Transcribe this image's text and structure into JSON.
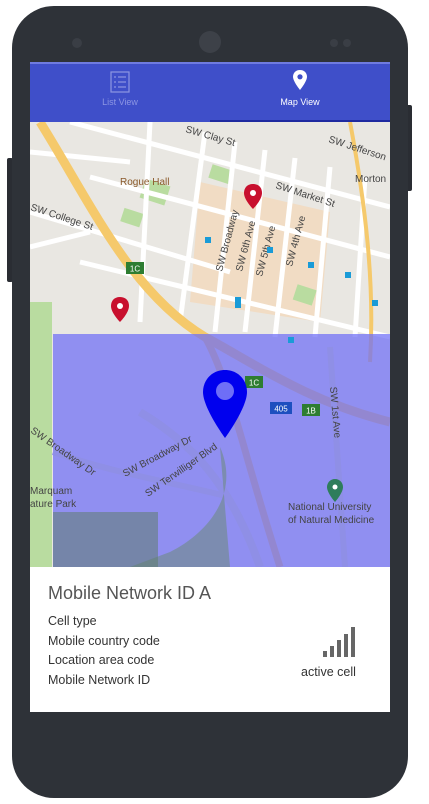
{
  "tabs": [
    {
      "label": "List View",
      "icon": "list-icon",
      "active": false
    },
    {
      "label": "Map View",
      "icon": "map-pin-icon",
      "active": true
    }
  ],
  "map": {
    "street_labels": {
      "clay": "SW Clay St",
      "jefferson": "SW Jefferson",
      "market": "SW Market St",
      "morton": "Morton",
      "rogue": "Rogue Hall",
      "college": "SW College St",
      "broadway": "SW Broadway",
      "sixth": "SW 6th Ave",
      "fifth": "SW 5th Ave",
      "fourth": "SW 4th Ave",
      "first": "SW 1st Ave",
      "broadway_dr_left": "SW Broadway Dr",
      "broadway_dr": "SW Broadway Dr",
      "terwilliger": "SW Terwilliger Blvd",
      "marquam1": "Marquam",
      "marquam2": "ature Park",
      "natural1": "National University",
      "natural2": "of Natural Medicine",
      "hwy_1c_a": "1C",
      "hwy_1c_b": "1C",
      "hwy_405": "405",
      "hwy_1b": "1B"
    },
    "colors": {
      "coverage_area": "#6e6ef7",
      "selected_marker": "#0000ee",
      "other_marker": "#c8102e",
      "poi_marker": "#2e7d5b"
    }
  },
  "info": {
    "title": "Mobile Network ID A",
    "rows": [
      "Cell type",
      "Mobile country code",
      "Location area code",
      "Mobile Network ID"
    ],
    "status": "active cell",
    "signal_icon": "signal-bars-icon"
  },
  "theme": {
    "primary": "#3f4fc9",
    "indicator": "#1f2aa0"
  }
}
